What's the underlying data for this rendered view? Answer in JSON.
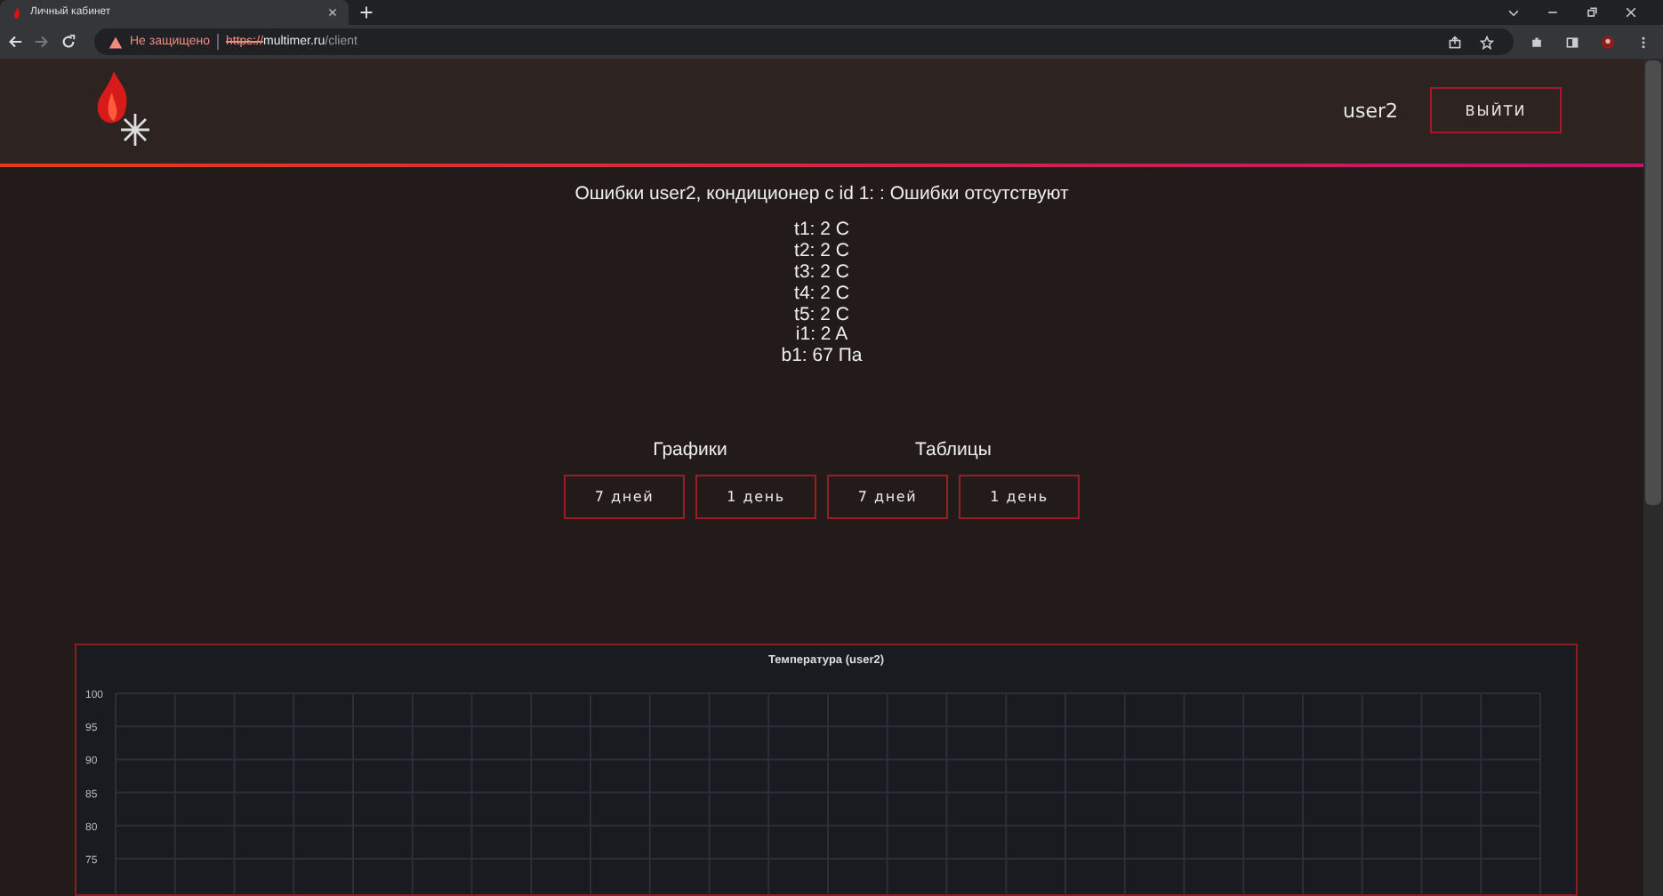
{
  "browser": {
    "tab_title": "Личный кабинет",
    "security": "Не защищено",
    "url_scheme": "https://",
    "url_host": "multimer.ru",
    "url_path": "/client"
  },
  "header": {
    "username": "user2",
    "logout": "ВЫЙТИ"
  },
  "errors": "Ошибки user2, кондиционер с id 1: : Ошибки отсутствуют",
  "readings": [
    "t1: 2 C",
    "t2: 2 C",
    "t3: 2 C",
    "t4: 2 C",
    "t5: 2 C",
    "i1: 2 A",
    "b1: 67 Па"
  ],
  "sections": [
    {
      "title": "Графики",
      "buttons": [
        "7 дней",
        "1 день"
      ]
    },
    {
      "title": "Таблицы",
      "buttons": [
        "7 дней",
        "1 день"
      ]
    }
  ],
  "chart": {
    "title": "Температура (user2)",
    "y_axis_labels": [
      "100",
      "95",
      "90",
      "85",
      "80",
      "75"
    ]
  }
}
